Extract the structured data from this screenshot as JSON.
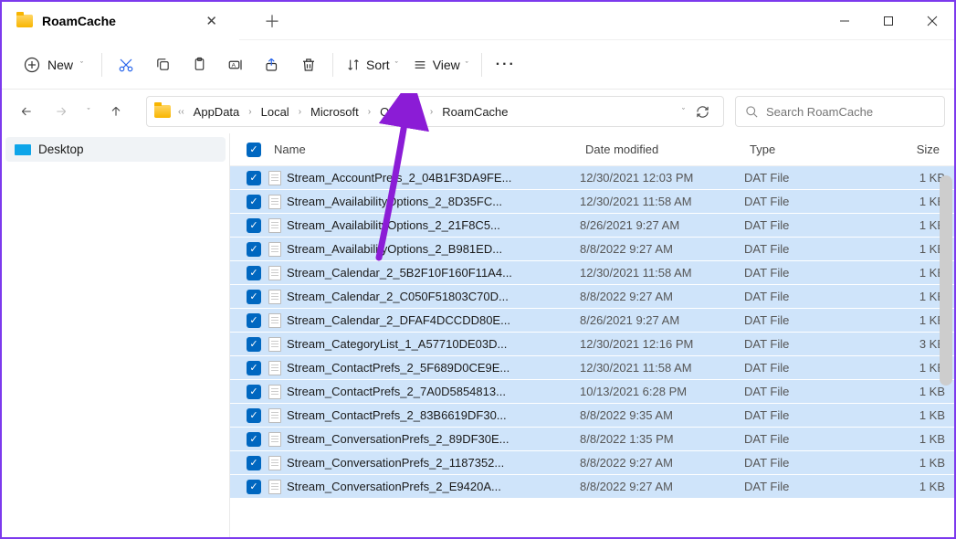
{
  "tab": {
    "title": "RoamCache"
  },
  "toolbar": {
    "new": "New",
    "sort": "Sort",
    "view": "View"
  },
  "breadcrumb": [
    "AppData",
    "Local",
    "Microsoft",
    "Outlook",
    "RoamCache"
  ],
  "search": {
    "placeholder": "Search RoamCache"
  },
  "sidebar": {
    "desktop": "Desktop"
  },
  "columns": {
    "name": "Name",
    "date": "Date modified",
    "type": "Type",
    "size": "Size"
  },
  "files": [
    {
      "name": "Stream_AccountPrefs_2_04B1F3DA9FE...",
      "date": "12/30/2021 12:03 PM",
      "type": "DAT File",
      "size": "1 KB"
    },
    {
      "name": "Stream_AvailabilityOptions_2_8D35FC...",
      "date": "12/30/2021 11:58 AM",
      "type": "DAT File",
      "size": "1 KB"
    },
    {
      "name": "Stream_AvailabilityOptions_2_21F8C5...",
      "date": "8/26/2021 9:27 AM",
      "type": "DAT File",
      "size": "1 KB"
    },
    {
      "name": "Stream_AvailabilityOptions_2_B981ED...",
      "date": "8/8/2022 9:27 AM",
      "type": "DAT File",
      "size": "1 KB"
    },
    {
      "name": "Stream_Calendar_2_5B2F10F160F11A4...",
      "date": "12/30/2021 11:58 AM",
      "type": "DAT File",
      "size": "1 KB"
    },
    {
      "name": "Stream_Calendar_2_C050F51803C70D...",
      "date": "8/8/2022 9:27 AM",
      "type": "DAT File",
      "size": "1 KB"
    },
    {
      "name": "Stream_Calendar_2_DFAF4DCCDD80E...",
      "date": "8/26/2021 9:27 AM",
      "type": "DAT File",
      "size": "1 KB"
    },
    {
      "name": "Stream_CategoryList_1_A57710DE03D...",
      "date": "12/30/2021 12:16 PM",
      "type": "DAT File",
      "size": "3 KB"
    },
    {
      "name": "Stream_ContactPrefs_2_5F689D0CE9E...",
      "date": "12/30/2021 11:58 AM",
      "type": "DAT File",
      "size": "1 KB"
    },
    {
      "name": "Stream_ContactPrefs_2_7A0D5854813...",
      "date": "10/13/2021 6:28 PM",
      "type": "DAT File",
      "size": "1 KB"
    },
    {
      "name": "Stream_ContactPrefs_2_83B6619DF30...",
      "date": "8/8/2022 9:35 AM",
      "type": "DAT File",
      "size": "1 KB"
    },
    {
      "name": "Stream_ConversationPrefs_2_89DF30E...",
      "date": "8/8/2022 1:35 PM",
      "type": "DAT File",
      "size": "1 KB"
    },
    {
      "name": "Stream_ConversationPrefs_2_1187352...",
      "date": "8/8/2022 9:27 AM",
      "type": "DAT File",
      "size": "1 KB"
    },
    {
      "name": "Stream_ConversationPrefs_2_E9420A...",
      "date": "8/8/2022 9:27 AM",
      "type": "DAT File",
      "size": "1 KB"
    }
  ]
}
